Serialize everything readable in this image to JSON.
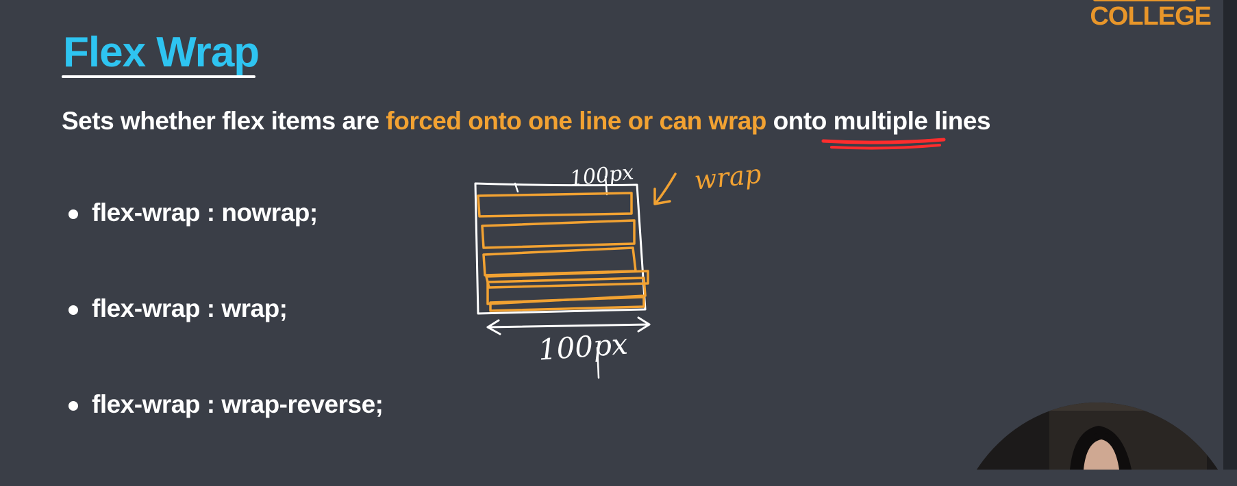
{
  "slide": {
    "title": "Flex Wrap",
    "subtitle_parts": [
      {
        "text": "Sets whether flex items are ",
        "highlight": false
      },
      {
        "text": "forced onto one line or can wrap",
        "highlight": true
      },
      {
        "text": " onto ",
        "highlight": false
      },
      {
        "text": "multiple lines",
        "highlight": false
      }
    ],
    "bullets": [
      "flex-wrap : nowrap;",
      "flex-wrap : wrap;",
      "flex-wrap : wrap-reverse;"
    ]
  },
  "logo": {
    "text": "COLLEGE"
  },
  "annotations": {
    "top_width_label": "100px",
    "wrap_label": "wrap",
    "bottom_width_label": "100px",
    "colors": {
      "ink_white": "#ffffff",
      "ink_orange": "#f2a232",
      "ink_red": "#ff2d2d",
      "text_highlight": "#f2a232",
      "title": "#2ec4f1",
      "background": "#3a3e47"
    }
  }
}
